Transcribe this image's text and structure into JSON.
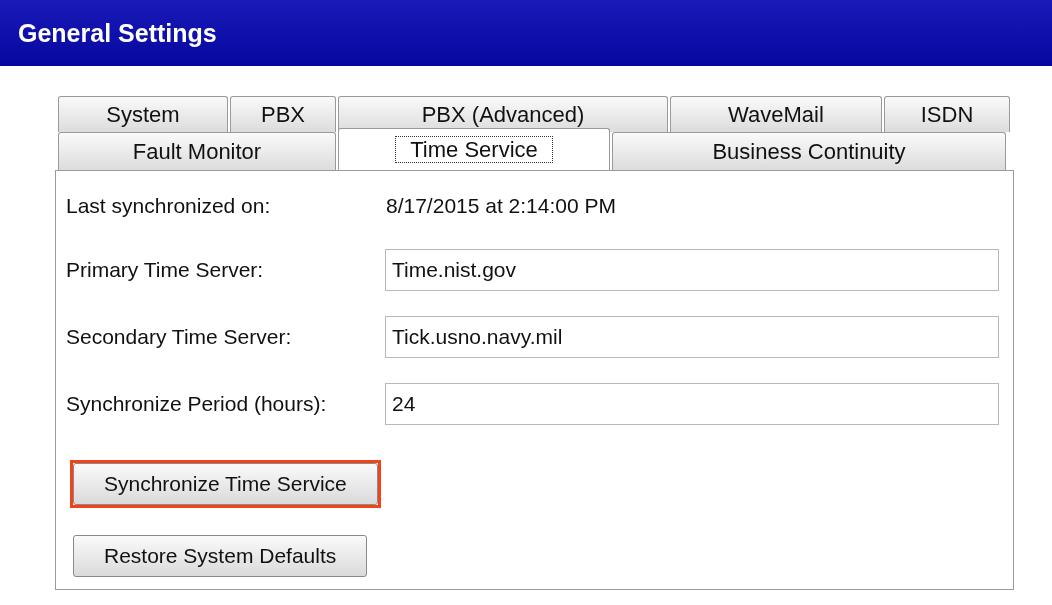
{
  "window": {
    "title": "General Settings"
  },
  "tab_rows": [
    [
      {
        "label": "System",
        "selected": false
      },
      {
        "label": "PBX",
        "selected": false
      },
      {
        "label": "PBX (Advanced)",
        "selected": false
      },
      {
        "label": "WaveMail",
        "selected": false
      },
      {
        "label": "ISDN",
        "selected": false
      }
    ],
    [
      {
        "label": "Fault Monitor",
        "selected": false
      },
      {
        "label": "Time Service",
        "selected": true
      },
      {
        "label": "Business Continuity",
        "selected": false
      }
    ]
  ],
  "last_synchronized": {
    "label": "Last synchronized on:",
    "value": "8/17/2015 at  2:14:00 PM"
  },
  "fields": [
    {
      "label": "Primary Time Server:",
      "value": "Time.nist.gov"
    },
    {
      "label": "Secondary Time Server:",
      "value": "Tick.usno.navy.mil"
    },
    {
      "label": "Synchronize Period (hours):",
      "value": "24"
    }
  ],
  "buttons": [
    {
      "label": "Synchronize Time Service",
      "highlighted": true
    },
    {
      "label": "Restore System Defaults",
      "highlighted": false
    }
  ]
}
